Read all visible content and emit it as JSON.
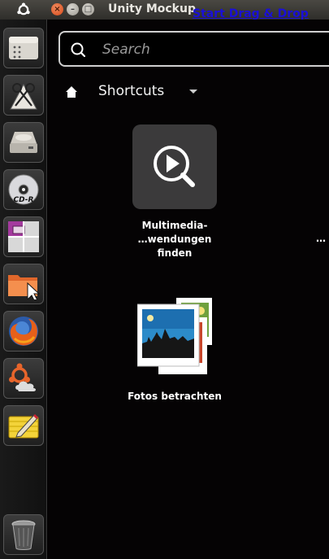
{
  "top_panel": {
    "window_title": "Unity Mockup",
    "drag_link": "Start Drag & Drop",
    "controls": {
      "close": "×",
      "minimize": "–",
      "maximize": "□"
    }
  },
  "launcher": {
    "items": [
      {
        "icon": "file-manager-icon"
      },
      {
        "icon": "cut-tools-icon"
      },
      {
        "icon": "hard-drive-icon"
      },
      {
        "icon": "cd-r-icon",
        "label": "CD-R"
      },
      {
        "icon": "workspace-switcher-icon"
      },
      {
        "icon": "folder-icon"
      },
      {
        "icon": "firefox-icon"
      },
      {
        "icon": "ubuntu-one-icon"
      },
      {
        "icon": "notes-icon"
      },
      {
        "icon": "trash-icon"
      }
    ]
  },
  "dash": {
    "search": {
      "placeholder": "Search",
      "value": ""
    },
    "filter": {
      "label": "Shortcuts"
    },
    "apps": [
      {
        "label": "Multimedia-\n…wendungen finden",
        "icon": "find-media-apps-icon"
      },
      {
        "label": "Fotos betrachten",
        "icon": "photos-icon"
      }
    ],
    "edge_label": "…"
  },
  "colors": {
    "link": "#1a0fd8",
    "close": "#d74a1a",
    "dash_bg": "#050304"
  }
}
